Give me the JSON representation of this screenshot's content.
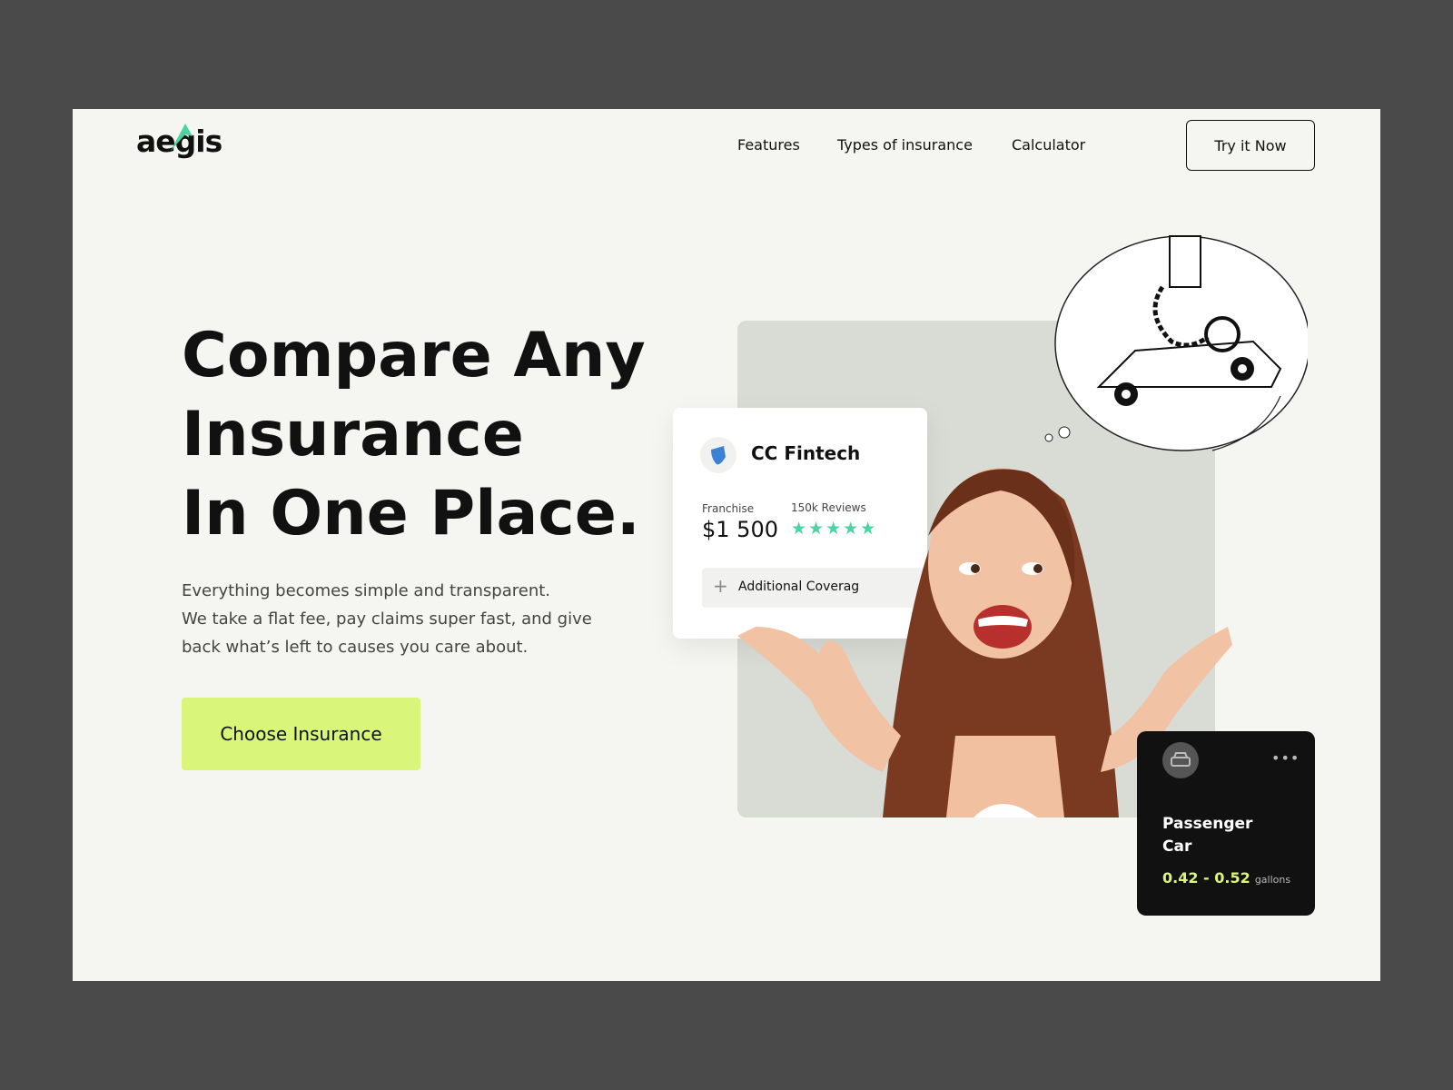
{
  "logo": {
    "text": "aegis",
    "accent": "#4cd3a0"
  },
  "nav": {
    "items": [
      "Features",
      "Types of insurance",
      "Calculator"
    ],
    "cta": "Try it Now"
  },
  "hero": {
    "title_lines": [
      "Compare Any",
      "Insurance",
      "In One Place."
    ],
    "paragraph_lines": [
      "Everything becomes simple and transparent.",
      "We take a flat fee, pay claims super fast, and give",
      "back what’s left to causes you care about."
    ],
    "cta": "Choose Insurance",
    "cta_color": "#d9f57a"
  },
  "card": {
    "company": "CC Fintech",
    "icon": "shield-icon",
    "franchise_label": "Franchise",
    "franchise_value": "$1 500",
    "reviews": "150k Reviews",
    "rating": 5,
    "star_color": "#4cd3a0",
    "coverage": "Additional Coverag"
  },
  "car_card": {
    "icon": "car-icon",
    "menu": "more-icon",
    "title_line1": "Passenger",
    "title_line2": "Car",
    "range": "0.42 - 0.52",
    "unit": "gallons",
    "accent": "#d9f57a"
  }
}
